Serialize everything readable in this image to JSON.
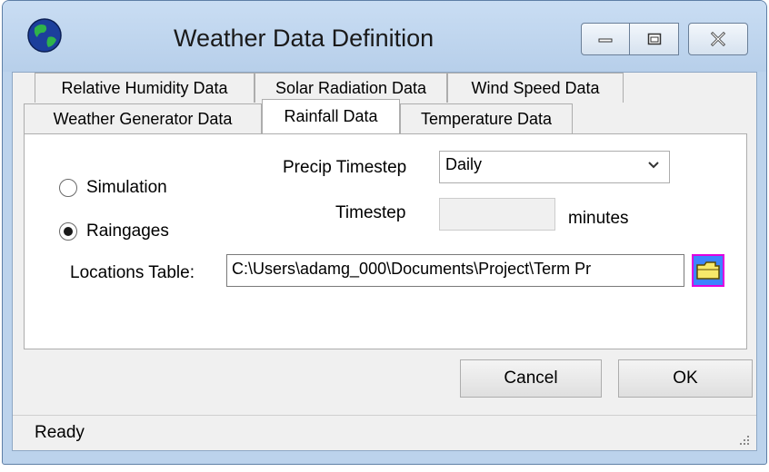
{
  "window": {
    "title": "Weather Data Definition"
  },
  "tabs": [
    {
      "label": "Relative Humidity Data",
      "active": false
    },
    {
      "label": "Solar Radiation Data",
      "active": false
    },
    {
      "label": "Wind Speed Data",
      "active": false
    },
    {
      "label": "Weather Generator Data",
      "active": false
    },
    {
      "label": "Rainfall Data",
      "active": true
    },
    {
      "label": "Temperature Data",
      "active": false
    }
  ],
  "rainfall": {
    "radio_simulation": {
      "label": "Simulation",
      "checked": false
    },
    "radio_raingages": {
      "label": "Raingages",
      "checked": true
    },
    "precip_timestep_label": "Precip Timestep",
    "precip_timestep_value": "Daily",
    "timestep_label": "Timestep",
    "timestep_value": "",
    "timestep_units": "minutes",
    "locations_label": "Locations Table:",
    "locations_value": "C:\\Users\\adamg_000\\Documents\\Project\\Term Pr"
  },
  "buttons": {
    "cancel": "Cancel",
    "ok": "OK"
  },
  "status": {
    "text": "Ready"
  },
  "icons": {
    "app": "globe-icon",
    "minimize": "minimize-icon",
    "maximize": "maximize-icon",
    "close": "close-icon",
    "dropdown": "chevron-down-icon",
    "browse": "folder-icon",
    "grip": "resize-grip-icon"
  },
  "colors": {
    "title_bar": "#bcd3ec",
    "client_bg": "#f0f0f0",
    "browse_button": "#3c83ff",
    "browse_border": "#e000e0"
  }
}
